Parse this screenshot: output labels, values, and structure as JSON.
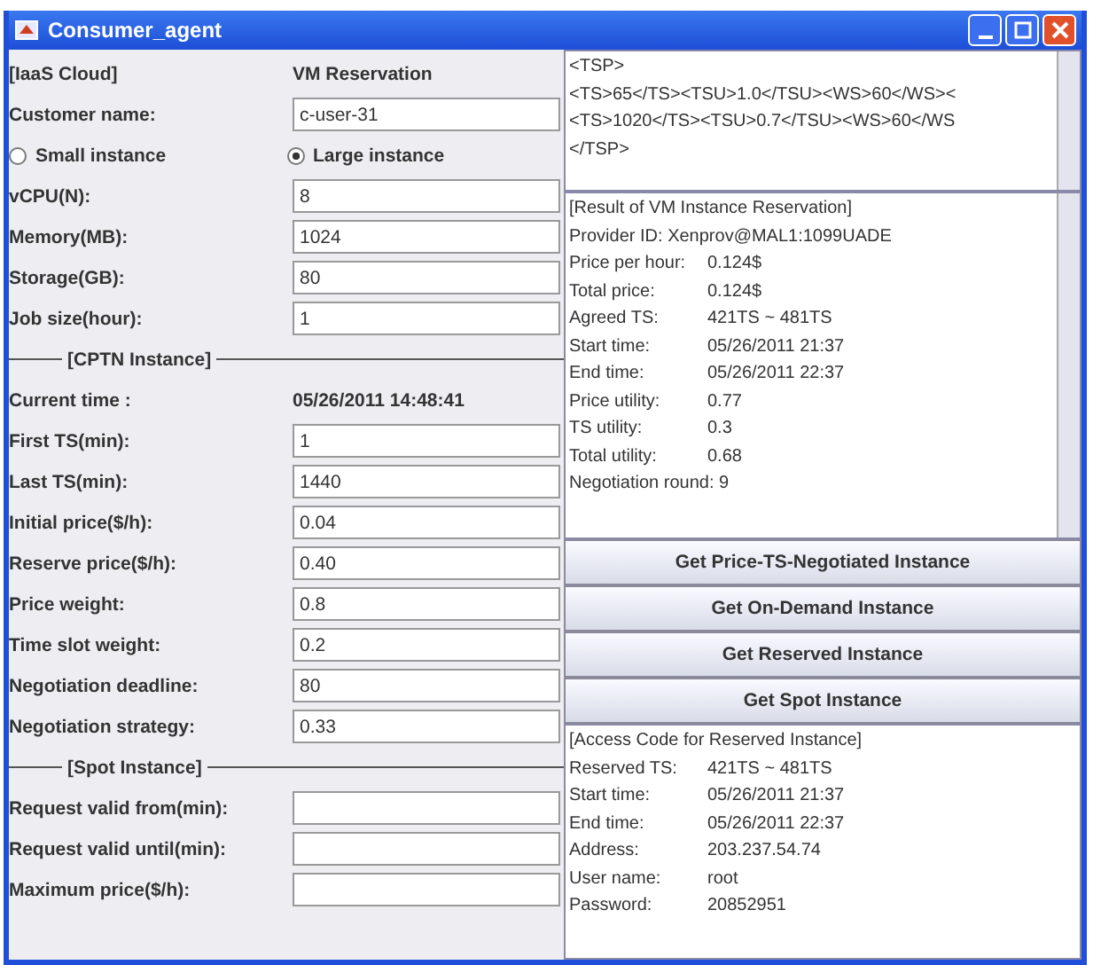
{
  "window": {
    "title": "Consumer_agent"
  },
  "form": [
    {
      "kind": "header",
      "label": "[IaaS Cloud]",
      "value": "VM Reservation"
    },
    {
      "kind": "field",
      "label": "Customer name:",
      "value": "c-user-31"
    },
    {
      "kind": "radios",
      "options": [
        {
          "label": "Small instance",
          "selected": false
        },
        {
          "label": "Large instance",
          "selected": true
        }
      ]
    },
    {
      "kind": "field",
      "label": "vCPU(N):",
      "value": "8"
    },
    {
      "kind": "field",
      "label": "Memory(MB):",
      "value": "1024"
    },
    {
      "kind": "field",
      "label": "Storage(GB):",
      "value": "80"
    },
    {
      "kind": "field",
      "label": "Job size(hour):",
      "value": "1"
    },
    {
      "kind": "section",
      "label": "[CPTN Instance]"
    },
    {
      "kind": "header",
      "label": "Current time :",
      "value": "05/26/2011 14:48:41"
    },
    {
      "kind": "field",
      "label": "First TS(min):",
      "value": "1"
    },
    {
      "kind": "field",
      "label": "Last TS(min):",
      "value": "1440"
    },
    {
      "kind": "field",
      "label": "Initial price($/h):",
      "value": "0.04"
    },
    {
      "kind": "field",
      "label": "Reserve price($/h):",
      "value": "0.40"
    },
    {
      "kind": "field",
      "label": "Price weight:",
      "value": "0.8"
    },
    {
      "kind": "field",
      "label": "Time slot weight:",
      "value": "0.2"
    },
    {
      "kind": "field",
      "label": "Negotiation deadline:",
      "value": "80"
    },
    {
      "kind": "field",
      "label": "Negotiation strategy:",
      "value": "0.33"
    },
    {
      "kind": "section",
      "label": "[Spot Instance]"
    },
    {
      "kind": "field",
      "label": "Request valid from(min):"
    },
    {
      "kind": "field",
      "label": "Request valid until(min):"
    },
    {
      "kind": "field",
      "label": "Maximum price($/h):"
    }
  ],
  "tsp_text": [
    "<TSP>",
    "<TS>65</TS><TSU>1.0</TSU><WS>60</WS><",
    "<TS>1020</TS><TSU>0.7</TSU><WS>60</WS",
    "</TSP>"
  ],
  "result": [
    {
      "label": "[Result of VM Instance Reservation]"
    },
    {
      "label": "Provider ID: Xenprov@MAL1:1099UADE"
    },
    {
      "label": "Price per hour:",
      "value": "0.124$"
    },
    {
      "label": "Total price:",
      "value": "0.124$"
    },
    {
      "label": "Agreed TS:",
      "value": "421TS ~ 481TS"
    },
    {
      "label": "Start time:",
      "value": "05/26/2011 21:37"
    },
    {
      "label": "End time:",
      "value": "05/26/2011 22:37"
    },
    {
      "label": "Price utility:",
      "value": "0.77"
    },
    {
      "label": "TS utility:",
      "value": "0.3"
    },
    {
      "label": "Total utility:",
      "value": "0.68"
    },
    {
      "label": "Negotiation round: 9"
    }
  ],
  "buttons": [
    "Get Price-TS-Negotiated Instance",
    "Get On-Demand Instance",
    "Get Reserved Instance",
    "Get Spot Instance"
  ],
  "access": [
    {
      "label": "[Access Code for Reserved Instance]"
    },
    {
      "label": "Reserved TS:",
      "value": "421TS ~ 481TS"
    },
    {
      "label": "Start time:",
      "value": "05/26/2011 21:37"
    },
    {
      "label": "End time:",
      "value": "05/26/2011 22:37"
    },
    {
      "label": "Address:",
      "value": "203.237.54.74"
    },
    {
      "label": "User name:",
      "value": "root"
    },
    {
      "label": "Password:",
      "value": "20852951"
    }
  ]
}
